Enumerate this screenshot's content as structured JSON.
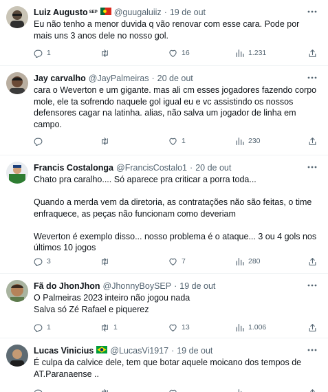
{
  "tweets": [
    {
      "name": "Luiz Augusto",
      "name_sup": "SEP",
      "handle": "@guugaluiiz",
      "time": "19 de out",
      "text": "Eu não tenho a menor duvida q vão renovar com esse cara. Pode por mais uns 3 anos dele no nosso gol.",
      "stats": {
        "replies": "1",
        "retweets": "",
        "likes": "16",
        "views": "1.231"
      }
    },
    {
      "name": "Jay carvalho",
      "handle": "@JayPalmeiras",
      "time": "20 de out",
      "text": "cara o Weverton e um gigante. mas ali cm esses jogadores fazendo corpo mole, ele ta sofrendo naquele gol igual eu e vc assistindo os nossos defensores cagar na latinha. alias, não salva um jogador de linha em campo.",
      "stats": {
        "replies": "",
        "retweets": "",
        "likes": "1",
        "views": "230"
      }
    },
    {
      "name": "Francis Costalonga",
      "handle": "@FrancisCostalo1",
      "time": "20 de out",
      "text": "Chato pra caralho.... Só aparece pra criticar a porra toda...\n\nQuando a merda vem da diretoria, as contratações não são feitas, o time enfraquece, as peças não funcionam como deveriam\n\nWeverton é exemplo disso... nosso problema é o ataque... 3 ou 4 gols nos últimos 10 jogos",
      "stats": {
        "replies": "3",
        "retweets": "",
        "likes": "7",
        "views": "280"
      }
    },
    {
      "name": "Fã do JhonJhon",
      "handle": "@JhonnyBoySEP",
      "time": "19 de out",
      "text": "O Palmeiras 2023 inteiro não jogou nada\nSalva só Zé Rafael e piquerez",
      "stats": {
        "replies": "1",
        "retweets": "1",
        "likes": "13",
        "views": "1.006"
      }
    },
    {
      "name": "Lucas Vinicius",
      "handle": "@LucasVi1917",
      "time": "19 de out",
      "text": "É culpa da calvice dele, tem que botar aquele moicano dos tempos de AT.Paranaense ..",
      "stats": {
        "replies": "",
        "retweets": "",
        "likes": "",
        "views": ""
      }
    }
  ],
  "icons": {
    "reply": "reply-icon",
    "retweet": "retweet-icon",
    "like": "heart-icon",
    "views": "views-chart-icon",
    "share": "share-icon",
    "more": "more-dots-icon"
  },
  "colors": {
    "text": "#0f1419",
    "muted": "#536471",
    "divider": "#eff3f4",
    "portugal_green": "#046a38",
    "portugal_red": "#da291c",
    "brazil_green": "#009c3b",
    "brazil_yellow": "#ffdf00",
    "brazil_blue": "#002776"
  }
}
